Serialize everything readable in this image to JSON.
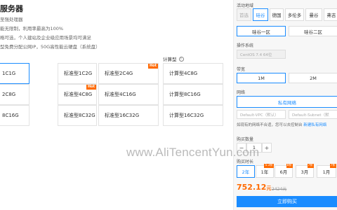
{
  "left": {
    "title": "服务器",
    "features": [
      "至强处理器",
      "能无限制，利用率最高为100%",
      "格可选，个人建站及企业级应用场景均可满足",
      "型免费分配公网IP，50G高性能云硬盘（系统盘）"
    ],
    "compute_header": "计算型",
    "info_icon": "info-icon",
    "hot_label": "Hot",
    "cards": [
      {
        "label": "1C1G",
        "selected": true,
        "hot": false
      },
      {
        "label": "标准型1C2G",
        "selected": false,
        "hot": false
      },
      {
        "label": "标准型2C4G",
        "selected": false,
        "hot": true
      },
      {
        "label": "计算型4C8G",
        "selected": false,
        "hot": false
      },
      {
        "label": "2C8G",
        "selected": false,
        "hot": false
      },
      {
        "label": "标准型4C8G",
        "selected": false,
        "hot": true
      },
      {
        "label": "标准型4C16G",
        "selected": false,
        "hot": false
      },
      {
        "label": "计算型8C16G",
        "selected": false,
        "hot": false
      },
      {
        "label": "8C16G",
        "selected": false,
        "hot": false
      },
      {
        "label": "标准型8C32G",
        "selected": false,
        "hot": false
      },
      {
        "label": "标准型16C32G",
        "selected": false,
        "hot": false
      },
      {
        "label": "计算型16C32G",
        "selected": false,
        "hot": false
      }
    ]
  },
  "right": {
    "region_label": "活动地域",
    "regions": [
      {
        "label": "首选",
        "state": "dim"
      },
      {
        "label": "硅谷",
        "state": "active"
      },
      {
        "label": "德国",
        "state": "normal"
      },
      {
        "label": "多伦多",
        "state": "normal"
      },
      {
        "label": "曼谷",
        "state": "normal"
      },
      {
        "label": "弗吉",
        "state": "normal"
      }
    ],
    "zones": [
      {
        "label": "硅谷一区",
        "active": true
      },
      {
        "label": "硅谷二区",
        "active": false
      }
    ],
    "os_label": "操作系统",
    "os_value": "CentOS 7.4 64位",
    "bandwidth_label": "带宽",
    "bandwidth": [
      {
        "label": "1M",
        "active": true
      },
      {
        "label": "2M",
        "active": false
      }
    ],
    "network_label": "网络",
    "network_value": "私有网络",
    "vpc_placeholder": "Default-VPC（默认）",
    "subnet_placeholder": "Default-Subnet（默",
    "network_note": "如现有的网络不合适，您可以去控制台",
    "network_link": "新建私有网络",
    "quantity_label": "购买数量",
    "quantity_minus": "−",
    "quantity_value": "1",
    "quantity_plus": "+",
    "duration_label": "购买时长",
    "durations": [
      {
        "label": "2年",
        "discount": "",
        "active": true
      },
      {
        "label": "1年",
        "discount": "5.3折",
        "active": false
      },
      {
        "label": "6月",
        "discount": "8折",
        "active": false
      },
      {
        "label": "3月",
        "discount": "7折",
        "active": false
      },
      {
        "label": "1月",
        "discount": "7折",
        "active": false
      }
    ],
    "price": "752.12",
    "price_unit": "元",
    "old_price": "2424元",
    "buy_label": "立即购买"
  },
  "watermark": "www.AliTencentYun.com",
  "colors": {
    "accent": "#1a8cff",
    "hot": "#ff6a00",
    "price": "#ff6a00"
  }
}
